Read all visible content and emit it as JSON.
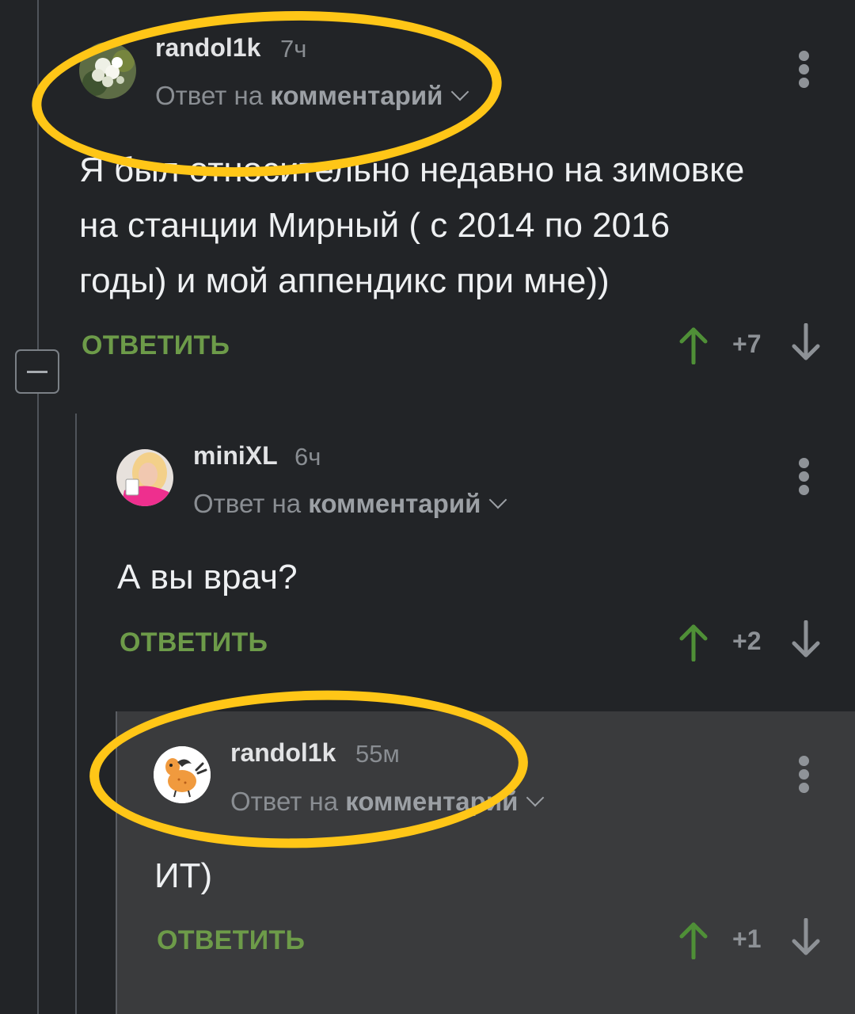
{
  "colors": {
    "background": "#222427",
    "highlight_background": "#3a3b3d",
    "reply_green": "#6d9b49",
    "upvote_green": "#4f8f37",
    "downvote_gray": "#8d9196",
    "annotation_yellow": "#ffc617"
  },
  "thread": {
    "collapse_icon": "minus-icon"
  },
  "comments": [
    {
      "username": "randol1k",
      "time": "7ч",
      "reply_prefix": "Ответ на",
      "reply_target": "комментарий",
      "body_lines": [
        "Я был относительно недавно на зимовке",
        "на станции Мирный ( с 2014 по 2016",
        "годы) и мой аппендикс при мне))"
      ],
      "reply_label": "ОТВЕТИТЬ",
      "score": "+7",
      "avatar_icon": "flowers-avatar"
    },
    {
      "username": "miniXL",
      "time": "6ч",
      "reply_prefix": "Ответ на",
      "reply_target": "комментарий",
      "body_lines": [
        "А вы врач?"
      ],
      "reply_label": "ОТВЕТИТЬ",
      "score": "+2",
      "avatar_icon": "woman-portrait-avatar"
    },
    {
      "username": "randol1k",
      "time": "55м",
      "reply_prefix": "Ответ на",
      "reply_target": "комментарий",
      "body_lines": [
        "ИТ)"
      ],
      "reply_label": "ОТВЕТИТЬ",
      "score": "+1",
      "avatar_icon": "cartoon-horse-avatar"
    }
  ]
}
